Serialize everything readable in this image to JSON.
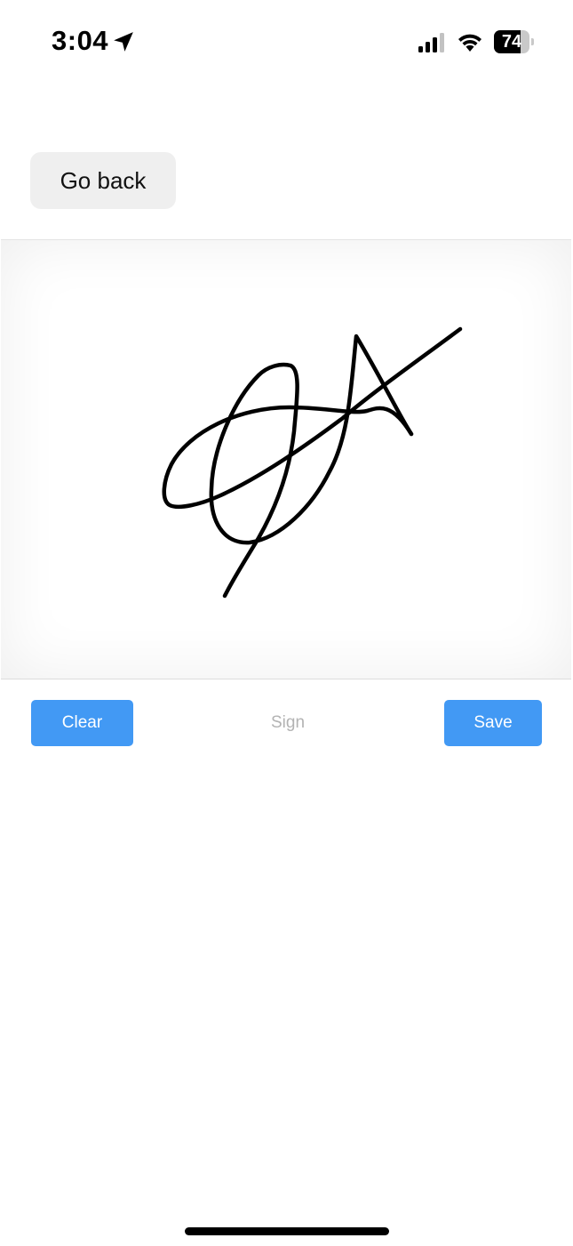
{
  "status_bar": {
    "time": "3:04",
    "battery_level": "74",
    "battery_fraction": 0.74
  },
  "header": {
    "back_label": "Go back"
  },
  "signature_pad": {
    "has_signature": true
  },
  "actions": {
    "clear_label": "Clear",
    "sign_label": "Sign",
    "save_label": "Save"
  },
  "colors": {
    "primary_button": "#4299f4",
    "primary_button_text": "#ffffff",
    "sign_label": "#b3b3b3",
    "back_button_bg": "#efefef",
    "stroke": "#000000"
  },
  "icons": {
    "location": "location-arrow-icon",
    "signal": "cellular-signal-icon",
    "wifi": "wifi-icon",
    "battery": "battery-icon"
  }
}
